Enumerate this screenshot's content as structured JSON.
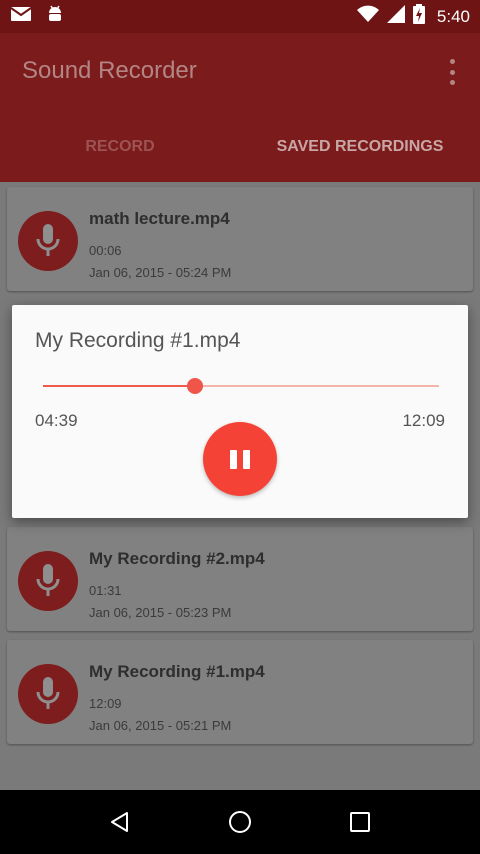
{
  "status_bar": {
    "time": "5:40"
  },
  "app_bar": {
    "title": "Sound Recorder",
    "tabs": [
      {
        "label": "RECORD",
        "selected": false
      },
      {
        "label": "SAVED RECORDINGS",
        "selected": true
      }
    ]
  },
  "recordings": [
    {
      "name": "math lecture.mp4",
      "duration": "00:06",
      "date": "Jan 06, 2015 - 05:24 PM"
    },
    {
      "name": "My Recording #2.mp4",
      "duration": "01:31",
      "date": "Jan 06, 2015 - 05:23 PM"
    },
    {
      "name": "My Recording #1.mp4",
      "duration": "12:09",
      "date": "Jan 06, 2015 - 05:21 PM"
    }
  ],
  "player_dialog": {
    "title": "My Recording #1.mp4",
    "elapsed": "04:39",
    "total": "12:09",
    "progress": 0.385
  },
  "colors": {
    "app_bar": "#7b1b1b",
    "accent": "#f44336",
    "mic_circle": "#7d1d1d"
  }
}
